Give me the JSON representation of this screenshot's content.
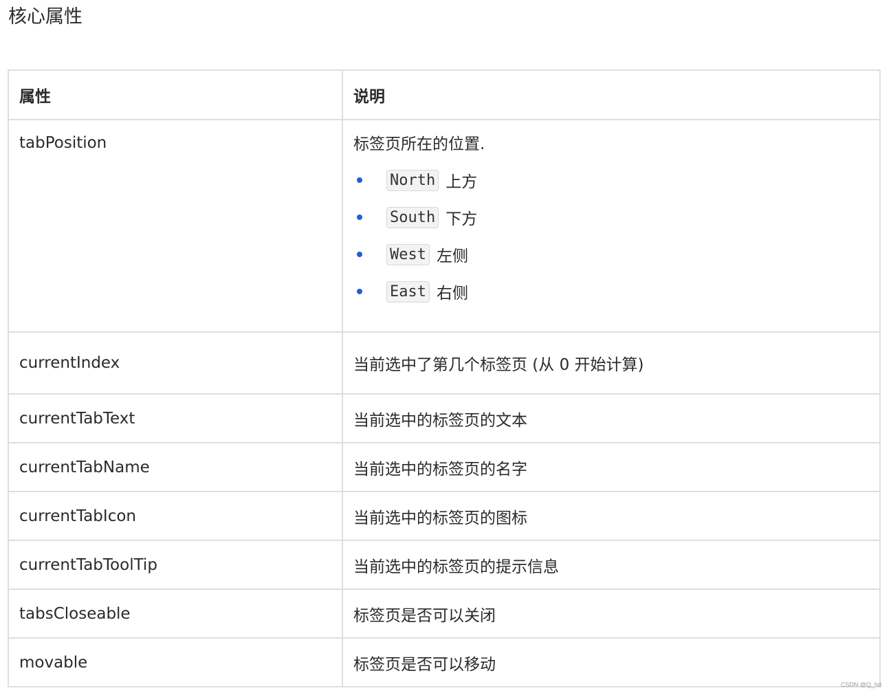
{
  "heading": "核心属性",
  "table": {
    "headers": [
      "属性",
      "说明"
    ],
    "tab_position": {
      "name": "tabPosition",
      "description": "标签页所在的位置.",
      "options": [
        {
          "code": "North",
          "label": "上方"
        },
        {
          "code": "South",
          "label": "下方"
        },
        {
          "code": "West",
          "label": "左侧"
        },
        {
          "code": "East",
          "label": "右侧"
        }
      ]
    },
    "rows": [
      {
        "name": "currentIndex",
        "description": "当前选中了第几个标签页 (从 0 开始计算)"
      },
      {
        "name": "currentTabText",
        "description": "当前选中的标签页的文本"
      },
      {
        "name": "currentTabName",
        "description": "当前选中的标签页的名字"
      },
      {
        "name": "currentTabIcon",
        "description": "当前选中的标签页的图标"
      },
      {
        "name": "currentTabToolTip",
        "description": "当前选中的标签页的提示信息"
      },
      {
        "name": "tabsCloseable",
        "description": "标签页是否可以关闭"
      },
      {
        "name": "movable",
        "description": "标签页是否可以移动"
      }
    ]
  },
  "colors": {
    "bullet": "#1e5fd6",
    "border": "#dedede",
    "code_bg": "#f3f3f3"
  },
  "watermark": "CSDN @Q_hd"
}
